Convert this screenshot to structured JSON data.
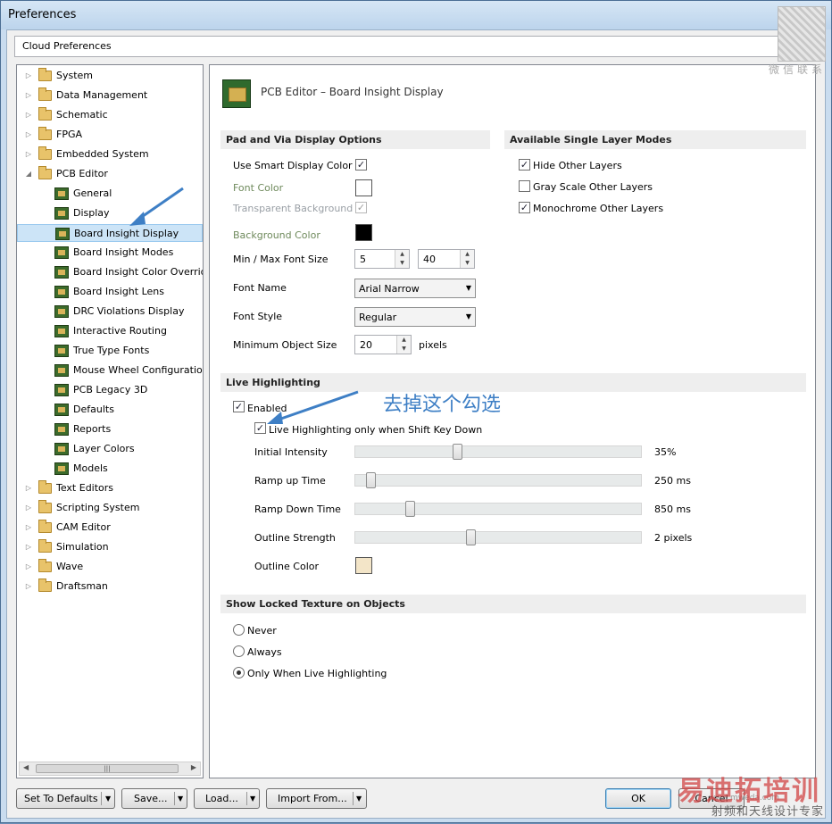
{
  "window": {
    "title": "Preferences"
  },
  "cloud": {
    "label": "Cloud Preferences"
  },
  "tree": {
    "items": [
      {
        "label": "System",
        "kind": "folder",
        "level": 0,
        "expanded": false,
        "icon": "folder-icon"
      },
      {
        "label": "Data Management",
        "kind": "folder",
        "level": 0,
        "expanded": false,
        "icon": "folder-icon"
      },
      {
        "label": "Schematic",
        "kind": "folder",
        "level": 0,
        "expanded": false,
        "icon": "folder-icon"
      },
      {
        "label": "FPGA",
        "kind": "folder",
        "level": 0,
        "expanded": false,
        "icon": "folder-icon"
      },
      {
        "label": "Embedded System",
        "kind": "folder",
        "level": 0,
        "expanded": false,
        "icon": "folder-icon"
      },
      {
        "label": "PCB Editor",
        "kind": "folder",
        "level": 0,
        "expanded": true,
        "icon": "folder-open-icon"
      },
      {
        "label": "General",
        "kind": "page",
        "level": 1,
        "icon": "pcb-icon"
      },
      {
        "label": "Display",
        "kind": "page",
        "level": 1,
        "icon": "pcb-icon"
      },
      {
        "label": "Board Insight Display",
        "kind": "page",
        "level": 1,
        "selected": true,
        "icon": "pcb-icon"
      },
      {
        "label": "Board Insight Modes",
        "kind": "page",
        "level": 1,
        "icon": "pcb-icon"
      },
      {
        "label": "Board Insight Color Overrid",
        "kind": "page",
        "level": 1,
        "icon": "pcb-icon"
      },
      {
        "label": "Board Insight Lens",
        "kind": "page",
        "level": 1,
        "icon": "pcb-icon"
      },
      {
        "label": "DRC Violations Display",
        "kind": "page",
        "level": 1,
        "icon": "pcb-icon"
      },
      {
        "label": "Interactive Routing",
        "kind": "page",
        "level": 1,
        "icon": "pcb-icon"
      },
      {
        "label": "True Type Fonts",
        "kind": "page",
        "level": 1,
        "icon": "pcb-icon"
      },
      {
        "label": "Mouse Wheel Configuration",
        "kind": "page",
        "level": 1,
        "icon": "pcb-icon"
      },
      {
        "label": "PCB Legacy 3D",
        "kind": "page",
        "level": 1,
        "icon": "pcb-icon"
      },
      {
        "label": "Defaults",
        "kind": "page",
        "level": 1,
        "icon": "pcb-icon"
      },
      {
        "label": "Reports",
        "kind": "page",
        "level": 1,
        "icon": "pcb-icon"
      },
      {
        "label": "Layer Colors",
        "kind": "page",
        "level": 1,
        "icon": "pcb-icon"
      },
      {
        "label": "Models",
        "kind": "page",
        "level": 1,
        "icon": "pcb-icon"
      },
      {
        "label": "Text Editors",
        "kind": "folder",
        "level": 0,
        "expanded": false,
        "icon": "folder-icon"
      },
      {
        "label": "Scripting System",
        "kind": "folder",
        "level": 0,
        "expanded": false,
        "icon": "folder-icon"
      },
      {
        "label": "CAM Editor",
        "kind": "folder",
        "level": 0,
        "expanded": false,
        "icon": "folder-icon"
      },
      {
        "label": "Simulation",
        "kind": "folder",
        "level": 0,
        "expanded": false,
        "icon": "folder-icon"
      },
      {
        "label": "Wave",
        "kind": "folder",
        "level": 0,
        "expanded": false,
        "icon": "folder-icon"
      },
      {
        "label": "Draftsman",
        "kind": "folder",
        "level": 0,
        "expanded": false,
        "icon": "folder-icon"
      }
    ]
  },
  "panel": {
    "title": "PCB Editor – Board Insight Display",
    "pad_via": {
      "heading": "Pad and Via Display Options",
      "use_smart_label": "Use Smart Display Color",
      "use_smart_checked": true,
      "font_color_label": "Font Color",
      "font_color": "#ffffff",
      "transparent_bg_label": "Transparent Background",
      "transparent_bg_checked": true,
      "background_color_label": "Background Color",
      "background_color": "#000000",
      "font_size_label": "Min / Max Font Size",
      "min_font": "5",
      "max_font": "40",
      "font_name_label": "Font Name",
      "font_name": "Arial Narrow",
      "font_style_label": "Font Style",
      "font_style": "Regular",
      "min_object_label": "Minimum Object Size",
      "min_object": "20",
      "min_object_unit": "pixels"
    },
    "layer_modes": {
      "heading": "Available Single Layer Modes",
      "items": [
        {
          "label": "Hide Other Layers",
          "checked": true
        },
        {
          "label": "Gray Scale Other Layers",
          "checked": false
        },
        {
          "label": "Monochrome Other Layers",
          "checked": true
        }
      ]
    },
    "live": {
      "heading": "Live Highlighting",
      "enabled_label": "Enabled",
      "enabled_checked": true,
      "shift_label": "Live Highlighting only when Shift Key Down",
      "shift_checked": true,
      "annotation": "去掉这个勾选",
      "sliders": [
        {
          "label": "Initial Intensity",
          "value_text": "35%",
          "position": 0.35
        },
        {
          "label": "Ramp up Time",
          "value_text": "250 ms",
          "position": 0.04
        },
        {
          "label": "Ramp Down Time",
          "value_text": "850 ms",
          "position": 0.18
        },
        {
          "label": "Outline Strength",
          "value_text": "2 pixels",
          "position": 0.4
        }
      ],
      "outline_color_label": "Outline Color",
      "outline_color": "#f3e5c8"
    },
    "locked": {
      "heading": "Show Locked Texture on Objects",
      "options": [
        {
          "label": "Never",
          "selected": false
        },
        {
          "label": "Always",
          "selected": false
        },
        {
          "label": "Only When Live Highlighting",
          "selected": true
        }
      ]
    }
  },
  "buttons": {
    "set_defaults": "Set To Defaults",
    "save": "Save...",
    "load": "Load...",
    "import": "Import From...",
    "ok": "OK",
    "cancel": "Cancel"
  },
  "watermark": {
    "qr_text": "微信联系",
    "brand": "易迪拓培训",
    "sub": "射频和天线设计专家",
    "url": "www.mweda.com"
  }
}
